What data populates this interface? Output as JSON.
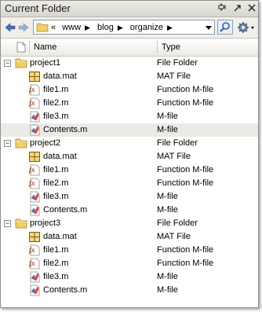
{
  "window": {
    "title": "Current Folder"
  },
  "titlebar_buttons": [
    "pin-icon",
    "undock-icon",
    "close-icon"
  ],
  "toolbar": {
    "breadcrumb": [
      "«",
      "www",
      "blog",
      "organize"
    ]
  },
  "columns": {
    "name": "Name",
    "type": "Type"
  },
  "rows": [
    {
      "kind": "folder",
      "level": 0,
      "name": "project1",
      "type": "File Folder"
    },
    {
      "kind": "mat",
      "level": 1,
      "name": "data.mat",
      "type": "MAT File"
    },
    {
      "kind": "func",
      "level": 1,
      "name": "file1.m",
      "type": "Function M-file"
    },
    {
      "kind": "func",
      "level": 1,
      "name": "file2.m",
      "type": "Function M-file"
    },
    {
      "kind": "mfile",
      "level": 1,
      "name": "file3.m",
      "type": "M-file"
    },
    {
      "kind": "mfile",
      "level": 1,
      "name": "Contents.m",
      "type": "M-file",
      "selected": true
    },
    {
      "kind": "folder",
      "level": 0,
      "name": "project2",
      "type": "File Folder"
    },
    {
      "kind": "mat",
      "level": 1,
      "name": "data.mat",
      "type": "MAT File"
    },
    {
      "kind": "func",
      "level": 1,
      "name": "file1.m",
      "type": "Function M-file"
    },
    {
      "kind": "func",
      "level": 1,
      "name": "file2.m",
      "type": "Function M-file"
    },
    {
      "kind": "mfile",
      "level": 1,
      "name": "file3.m",
      "type": "M-file"
    },
    {
      "kind": "mfile",
      "level": 1,
      "name": "Contents.m",
      "type": "M-file"
    },
    {
      "kind": "folder",
      "level": 0,
      "name": "project3",
      "type": "File Folder"
    },
    {
      "kind": "mat",
      "level": 1,
      "name": "data.mat",
      "type": "MAT File"
    },
    {
      "kind": "func",
      "level": 1,
      "name": "file1.m",
      "type": "Function M-file"
    },
    {
      "kind": "func",
      "level": 1,
      "name": "file2.m",
      "type": "Function M-file"
    },
    {
      "kind": "mfile",
      "level": 1,
      "name": "file3.m",
      "type": "M-file"
    },
    {
      "kind": "mfile",
      "level": 1,
      "name": "Contents.m",
      "type": "M-file"
    }
  ],
  "colors": {
    "selected_row": "#eceae6",
    "folder": "#f2cf63",
    "mat_grid": "#e4b22e"
  }
}
